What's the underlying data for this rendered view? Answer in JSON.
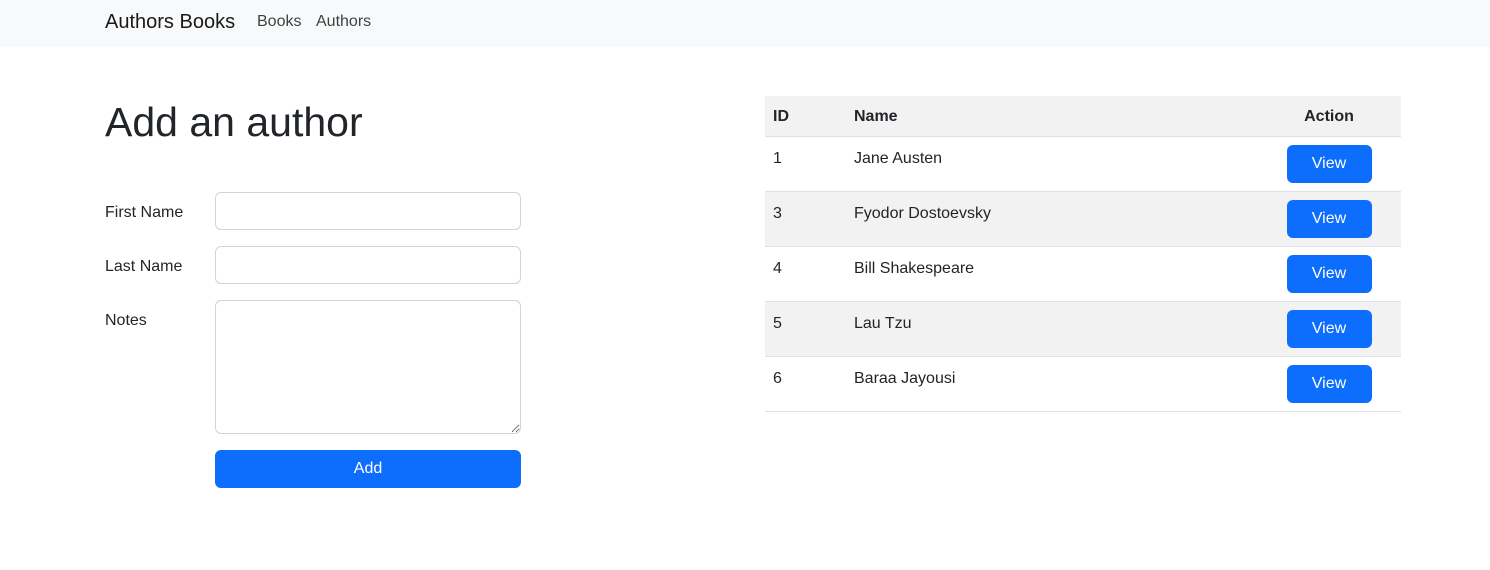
{
  "navbar": {
    "brand": "Authors Books",
    "links": [
      "Books",
      "Authors"
    ]
  },
  "form": {
    "title": "Add an author",
    "first_name_label": "First Name",
    "first_name_value": "",
    "last_name_label": "Last Name",
    "last_name_value": "",
    "notes_label": "Notes",
    "notes_value": "",
    "add_label": "Add"
  },
  "table": {
    "headers": [
      "ID",
      "Name",
      "Action"
    ],
    "rows": [
      {
        "id": "1",
        "name": "Jane Austen",
        "action": "View"
      },
      {
        "id": "3",
        "name": "Fyodor Dostoevsky",
        "action": "View"
      },
      {
        "id": "4",
        "name": "Bill Shakespeare",
        "action": "View"
      },
      {
        "id": "5",
        "name": "Lau Tzu",
        "action": "View"
      },
      {
        "id": "6",
        "name": "Baraa Jayousi",
        "action": "View"
      }
    ]
  },
  "colors": {
    "primary": "#0d6efd",
    "navbar_bg": "#f8f9fa",
    "stripe": "#f2f2f2"
  }
}
